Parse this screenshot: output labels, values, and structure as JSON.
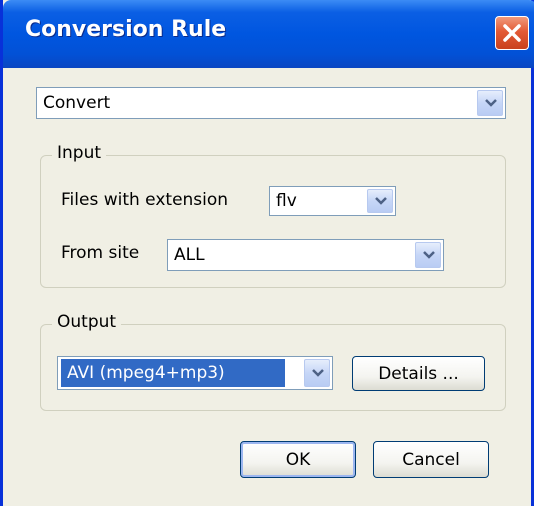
{
  "window": {
    "title": "Conversion Rule"
  },
  "rule_type": {
    "value": "Convert"
  },
  "input": {
    "legend": "Input",
    "extension_label": "Files with extension",
    "extension_value": "flv",
    "site_label": "From site",
    "site_value": "ALL"
  },
  "output": {
    "legend": "Output",
    "format_value": "AVI (mpeg4+mp3)",
    "details_label": "Details ..."
  },
  "buttons": {
    "ok": "OK",
    "cancel": "Cancel"
  },
  "icons": {
    "close": "close-icon",
    "dropdown": "chevron-down-icon"
  },
  "colors": {
    "titlebar": "#0056e0",
    "close": "#e35a35",
    "selection": "#316ac5",
    "face": "#f0efe4"
  }
}
